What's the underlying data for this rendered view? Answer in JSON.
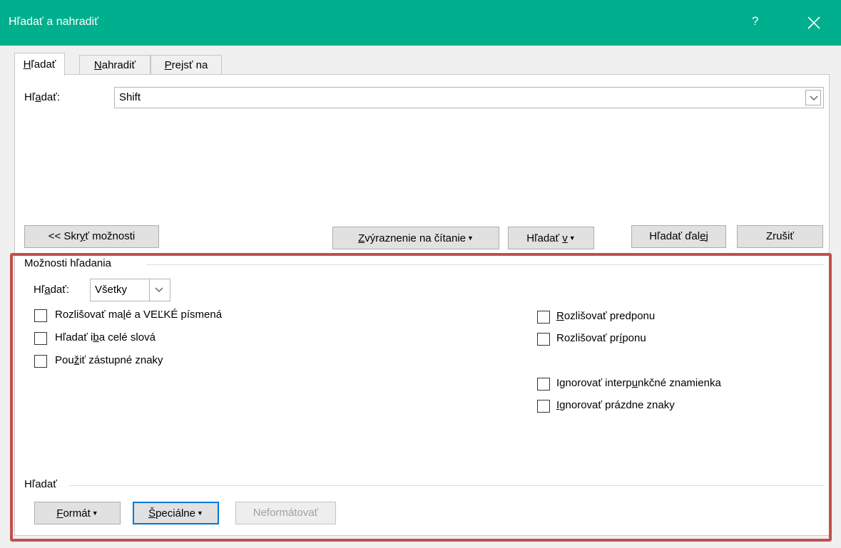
{
  "window": {
    "title": "Hľadať a nahradiť",
    "help": "?",
    "close_icon": "close-icon"
  },
  "tabs": [
    {
      "pre": "",
      "ul": "H",
      "post": "ľadať",
      "active": true
    },
    {
      "pre": "",
      "ul": "N",
      "post": "ahradiť",
      "active": false
    },
    {
      "pre": "",
      "ul": "P",
      "post": "rejsť na",
      "active": false
    }
  ],
  "find": {
    "label_pre": "Hľ",
    "label_ul": "a",
    "label_post": "dať:",
    "value": "Shift"
  },
  "buttons": {
    "hide_options": {
      "pre": "<< Skr",
      "ul": "y",
      "post": "ť možnosti"
    },
    "reading_highlight": {
      "pre": "",
      "ul": "Z",
      "post": "výraznenie na čítanie"
    },
    "find_in": {
      "pre": "Hľadať ",
      "ul": "v",
      "post": ""
    },
    "find_next": {
      "pre": "Hľadať ďal",
      "ul": "e",
      "post": "j"
    },
    "cancel": "Zrušiť"
  },
  "options": {
    "group_title": "Možnosti hľadania",
    "search_label": {
      "pre": "Hľ",
      "ul": "a",
      "post": "dať:"
    },
    "search_value": "Všetky",
    "left_checkboxes": [
      {
        "pre": "Rozlišovať ma",
        "ul": "l",
        "post": "é a VEĽKÉ písmená",
        "checked": false
      },
      {
        "pre": "Hľadať i",
        "ul": "b",
        "post": "a celé slová",
        "checked": false
      },
      {
        "pre": "Pou",
        "ul": "ž",
        "post": "iť zástupné znaky",
        "checked": false
      }
    ],
    "right_checkboxes": [
      {
        "pre": "",
        "ul": "R",
        "post": "ozlišovať predponu",
        "checked": false
      },
      {
        "pre": "Rozlišovať pr",
        "ul": "í",
        "post": "ponu",
        "checked": false
      },
      {
        "pre": "Ignorovať interp",
        "ul": "u",
        "post": "nkčné znamienka",
        "checked": false
      },
      {
        "pre": "",
        "ul": "I",
        "post": "gnorovať prázdne znaky",
        "checked": false
      }
    ]
  },
  "find_group": {
    "title": "Hľadať",
    "format": {
      "pre": "",
      "ul": "F",
      "post": "ormát"
    },
    "special": {
      "pre": "",
      "ul": "Š",
      "post": "peciálne"
    },
    "no_format": "Neformátovať"
  },
  "colors": {
    "titlebar": "#00af8e",
    "highlight_border": "#c0504d",
    "focus_border": "#0078d7"
  }
}
